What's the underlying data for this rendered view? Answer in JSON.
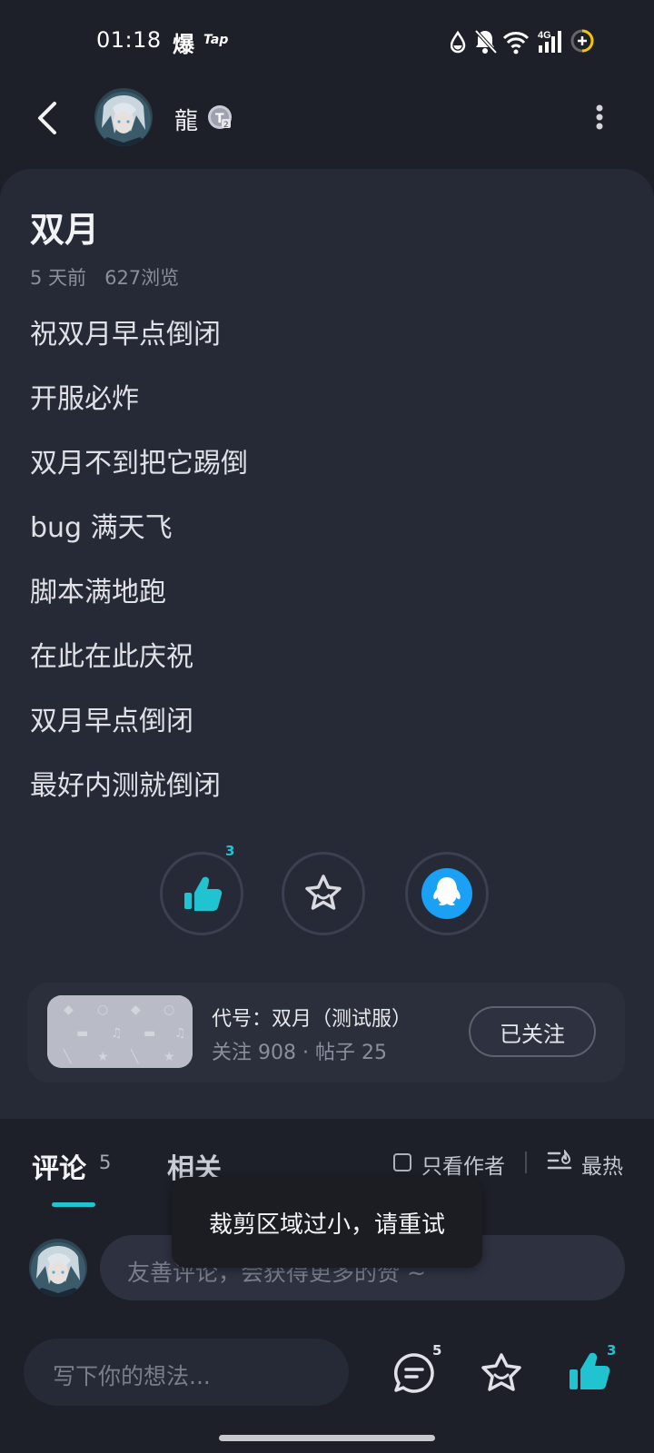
{
  "status_bar": {
    "time": "01:18",
    "app_icon_1": "爆",
    "app_icon_2": "Tap",
    "network": "4G",
    "icons": [
      "water-drop-icon",
      "bell-off-icon",
      "wifi-icon",
      "signal-icon",
      "battery-icon"
    ]
  },
  "header": {
    "author_name": "龍",
    "badge_icon": "level-badge-icon"
  },
  "post": {
    "title": "双月",
    "time_ago": "5 天前",
    "views": "627浏览",
    "lines": [
      "祝双月早点倒闭",
      "开服必炸",
      "双月不到把它踢倒",
      "bug 满天飞",
      "脚本满地跑",
      "在此在此庆祝",
      "双月早点倒闭",
      "最好内测就倒闭"
    ],
    "like_count": "3"
  },
  "forum": {
    "name": "代号：双月（测试服）",
    "stats": "关注 908 · 帖子 25",
    "follow_label": "已关注"
  },
  "tabs": {
    "comments_label": "评论",
    "comments_count": "5",
    "related_label": "相关",
    "author_only_label": "只看作者",
    "sort_label": "最热"
  },
  "comment_box": {
    "placeholder": "友善评论，会获得更多的赞 ~"
  },
  "toast": {
    "message": "裁剪区域过小，请重试"
  },
  "bottom_bar": {
    "input_placeholder": "写下你的想法...",
    "comment_count": "5",
    "like_count": "3"
  },
  "colors": {
    "accent": "#20c3cf",
    "qq_blue": "#1aa0f5",
    "card_bg": "#262936",
    "page_bg": "#1d2029"
  }
}
